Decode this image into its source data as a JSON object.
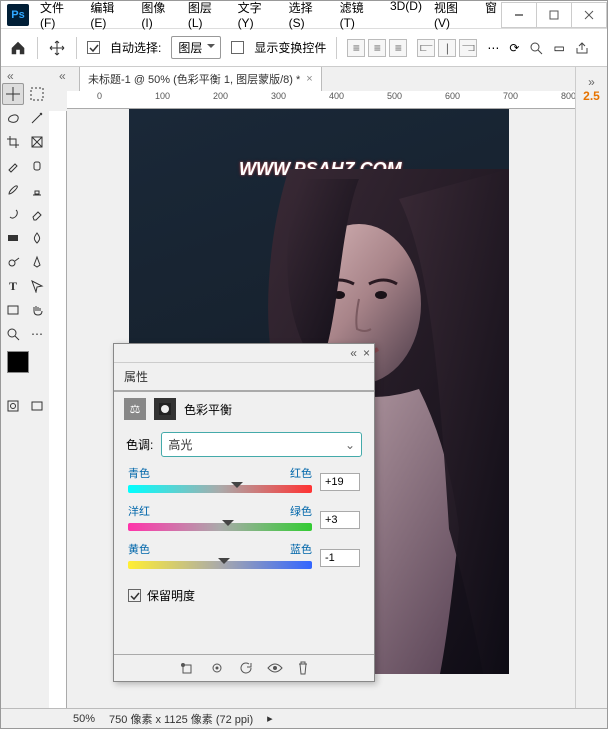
{
  "menu": {
    "file": "文件(F)",
    "edit": "编辑(E)",
    "image": "图像(I)",
    "layer": "图层(L)",
    "type": "文字(Y)",
    "select": "选择(S)",
    "filter": "滤镜(T)",
    "threeD": "3D(D)",
    "view": "视图(V)",
    "window": "窗"
  },
  "opt": {
    "auto": "自动选择:",
    "target": "图层",
    "show": "显示变换控件"
  },
  "doc": {
    "tab": "未标题-1 @ 50% (色彩平衡 1, 图层蒙版/8) *"
  },
  "ruler_h": [
    "0",
    "100",
    "200",
    "300",
    "400",
    "500",
    "600",
    "700",
    "800"
  ],
  "watermark": "WWW.PSAHZ.COM",
  "panel": {
    "title": "属性",
    "sub": "色彩平衡",
    "tone_label": "色调:",
    "tone_value": "高光",
    "s": [
      {
        "l": "青色",
        "r": "红色",
        "v": "+19",
        "pos": 56
      },
      {
        "l": "洋红",
        "r": "绿色",
        "v": "+3",
        "pos": 51
      },
      {
        "l": "黄色",
        "r": "蓝色",
        "v": "-1",
        "pos": 49
      }
    ],
    "preserve": "保留明度"
  },
  "side": {
    "version": "2.5"
  },
  "status": {
    "zoom": "50%",
    "info": "750 像素 x 1125 像素 (72 ppi)"
  }
}
